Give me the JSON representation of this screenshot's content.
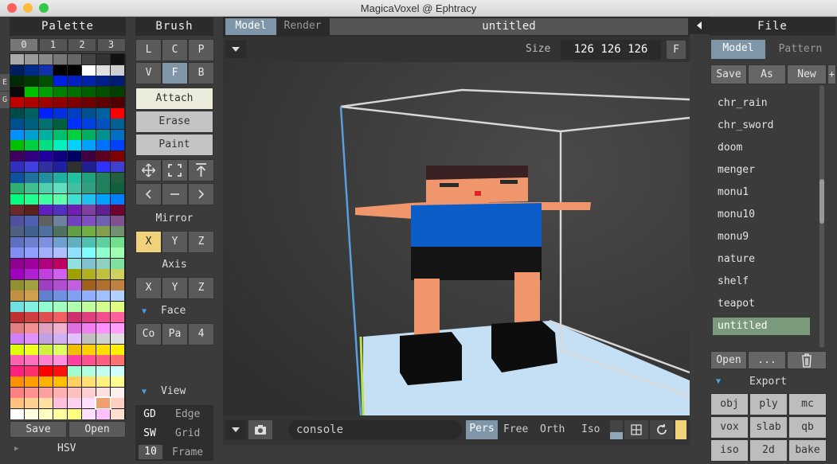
{
  "window_title": "MagicaVoxel @ Ephtracy",
  "palette": {
    "title": "Palette",
    "tabs": [
      "0",
      "1",
      "2",
      "3"
    ],
    "side_tabs": [
      "E",
      "G"
    ],
    "save_label": "Save",
    "open_label": "Open",
    "hsv_label": "HSV",
    "selected_color": "#f0a070"
  },
  "brush": {
    "title": "Brush",
    "type_row1": [
      "L",
      "C",
      "P"
    ],
    "type_row2": [
      "V",
      "F",
      "B"
    ],
    "modes": [
      "Attach",
      "Erase",
      "Paint"
    ],
    "mirror_label": "Mirror",
    "mirror_axes": [
      "X",
      "Y",
      "Z"
    ],
    "axis_label": "Axis",
    "axis_axes": [
      "X",
      "Y",
      "Z"
    ],
    "face_label": "Face",
    "face_items": [
      "Co",
      "Pa",
      "4"
    ],
    "view_label": "View",
    "view_rows": [
      {
        "key": "GD",
        "label": "Edge"
      },
      {
        "key": "SW",
        "label": "Grid"
      },
      {
        "key": "10",
        "label": "Frame"
      }
    ]
  },
  "viewport": {
    "tab_model": "Model",
    "tab_render": "Render",
    "doc_name": "untitled",
    "size_label": "Size",
    "size_value": "126 126 126",
    "f_button": "F",
    "console_placeholder": "console",
    "camera_modes": [
      "Pers",
      "Free",
      "Orth",
      "Iso"
    ],
    "active_camera": "Pers"
  },
  "file": {
    "title": "File",
    "tab_model": "Model",
    "tab_pattern": "Pattern",
    "save_label": "Save",
    "as_label": "As",
    "new_label": "New",
    "plus_label": "+",
    "items": [
      "chr_rain",
      "chr_sword",
      "doom",
      "menger",
      "monu1",
      "monu10",
      "monu9",
      "nature",
      "shelf",
      "teapot",
      "untitled"
    ],
    "selected_item": "untitled",
    "open_label": "Open",
    "more_label": "...",
    "export_label": "Export",
    "export_formats": [
      "obj",
      "ply",
      "mc",
      "vox",
      "slab",
      "qb",
      "iso",
      "2d",
      "bake"
    ]
  },
  "colors": {
    "accent_yellow": "#f0d27a",
    "selected_green": "#7b9a7c",
    "floor_blue": "#c5dff5"
  }
}
